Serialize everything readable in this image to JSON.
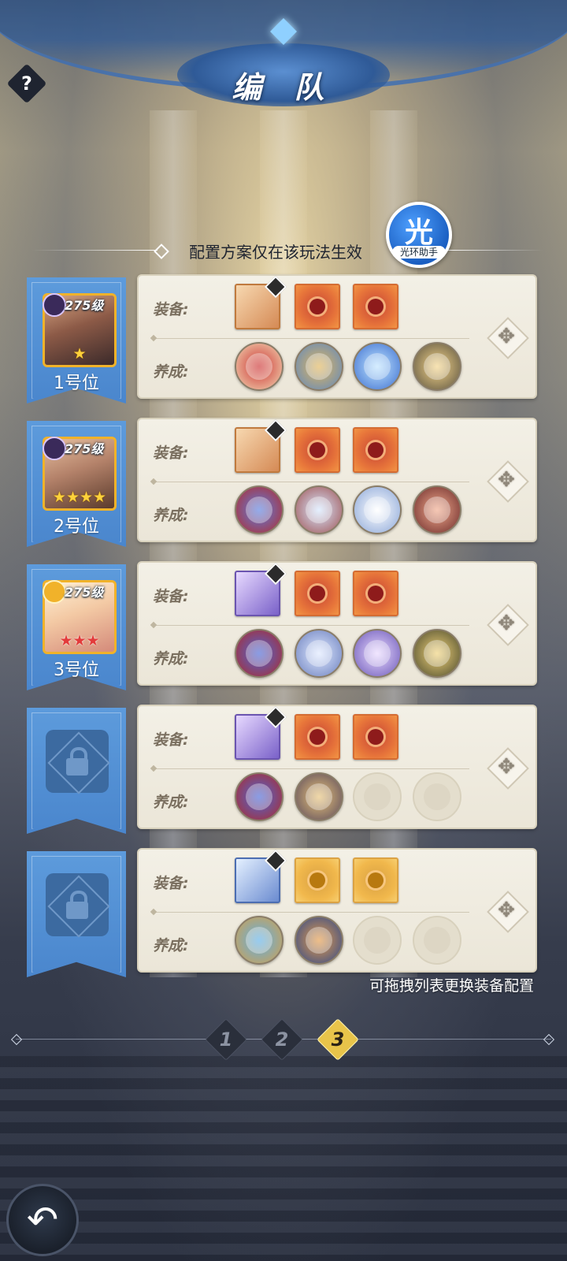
{
  "header": {
    "title": "编 队",
    "help_label": "?"
  },
  "notice": {
    "text": "配置方案仅在该玩法生效"
  },
  "helper": {
    "glyph": "光",
    "label": "光环助手"
  },
  "rows": [
    {
      "position_label": "1号位",
      "level": "275级",
      "stars": "★",
      "locked": false,
      "equip_label": "装备:",
      "develop_label": "养成:"
    },
    {
      "position_label": "2号位",
      "level": "275级",
      "stars": "★★★★",
      "locked": false,
      "equip_label": "装备:",
      "develop_label": "养成:"
    },
    {
      "position_label": "3号位",
      "level": "275级",
      "stars": "★★★",
      "locked": false,
      "equip_label": "装备:",
      "develop_label": "养成:"
    },
    {
      "locked": true,
      "equip_label": "装备:",
      "develop_label": "养成:"
    },
    {
      "locked": true,
      "equip_label": "装备:",
      "develop_label": "养成:"
    }
  ],
  "hint": "可拖拽列表更换装备配置",
  "pager": {
    "pages": [
      "1",
      "2",
      "3"
    ],
    "active": "3"
  },
  "icons": {
    "help": "question-mark-icon",
    "move": "move-arrows-icon",
    "lock": "lock-icon",
    "back": "back-arrow-icon"
  },
  "colors": {
    "banner_blue": "#4a86cd",
    "panel_bg": "#f3f0e6",
    "active_page": "#e8c44a",
    "helper_blue": "#1b5fc2"
  }
}
